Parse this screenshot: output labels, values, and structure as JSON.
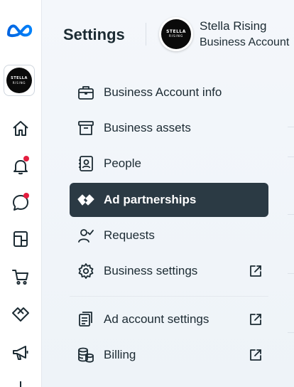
{
  "rail": {
    "logo": "meta-logo-icon",
    "account_tile": {
      "line1": "STELLA",
      "line2": "RISING"
    },
    "items": [
      {
        "icon": "home-icon"
      },
      {
        "icon": "bell-icon",
        "notification": true
      },
      {
        "icon": "chat-icon",
        "notification": true
      },
      {
        "icon": "pages-icon"
      },
      {
        "icon": "cart-icon"
      },
      {
        "icon": "partnership-icon"
      },
      {
        "icon": "megaphone-icon"
      }
    ]
  },
  "header": {
    "title": "Settings",
    "account_name": "Stella Rising",
    "account_type": "Business Account"
  },
  "menu": {
    "items": [
      {
        "label": "Business Account info",
        "icon": "briefcase-icon",
        "external": false,
        "active": false
      },
      {
        "label": "Business assets",
        "icon": "archive-box-icon",
        "external": false,
        "active": false
      },
      {
        "label": "People",
        "icon": "id-badge-icon",
        "external": false,
        "active": false
      },
      {
        "label": "Ad partnerships",
        "icon": "handshake-icon",
        "external": false,
        "active": true
      },
      {
        "label": "Requests",
        "icon": "person-check-icon",
        "external": false,
        "active": false
      },
      {
        "label": "Business settings",
        "icon": "gear-icon",
        "external": true,
        "active": false
      },
      {
        "label": "Ad account settings",
        "icon": "ad-account-icon",
        "external": true,
        "active": false
      },
      {
        "label": "Billing",
        "icon": "coins-icon",
        "external": true,
        "active": false
      }
    ]
  },
  "colors": {
    "active_bg": "#2b3a44",
    "notification": "#e41e3f",
    "meta_blue": "#0866ff",
    "text": "#1c2b33"
  }
}
